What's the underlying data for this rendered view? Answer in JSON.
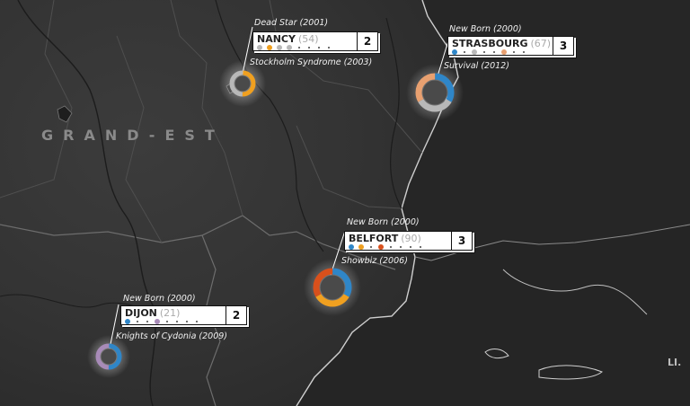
{
  "region": {
    "label": "GRAND-EST"
  },
  "edge_label": "LI.",
  "colors": {
    "blue": "#2f86c8",
    "orange": "#f0a020",
    "grey": "#b8b8b8",
    "salmon": "#e8a070",
    "darkorange": "#d8501c",
    "purple": "#a88bb8"
  },
  "cities": [
    {
      "name": "NANCY",
      "count": "(54)",
      "rank": "2",
      "song_top": "Dead Star (2001)",
      "song_bottom": "Stockholm Syndrome (2003)",
      "dots": [
        "grey",
        "orange",
        "grey",
        "grey",
        "",
        "",
        "",
        ""
      ],
      "ring": [
        "orange",
        "grey"
      ]
    },
    {
      "name": "STRASBOURG",
      "count": "(67)",
      "rank": "3",
      "song_top": "New Born (2000)",
      "song_bottom": "Survival (2012)",
      "dots": [
        "blue",
        "",
        "grey",
        "",
        "",
        "salmon",
        "",
        ""
      ],
      "ring": [
        "blue",
        "grey",
        "salmon"
      ]
    },
    {
      "name": "BELFORT",
      "count": "(90)",
      "rank": "3",
      "song_top": "New Born (2000)",
      "song_bottom": "Showbiz (2006)",
      "dots": [
        "blue",
        "orange",
        "",
        "darkorange",
        "",
        "",
        "",
        ""
      ],
      "ring": [
        "blue",
        "orange",
        "darkorange"
      ]
    },
    {
      "name": "DIJON",
      "count": "(21)",
      "rank": "2",
      "song_top": "New Born (2000)",
      "song_bottom": "Knights of Cydonia (2009)",
      "dots": [
        "blue",
        "",
        "",
        "purple",
        "",
        "",
        "",
        ""
      ],
      "ring": [
        "blue",
        "purple"
      ]
    }
  ]
}
